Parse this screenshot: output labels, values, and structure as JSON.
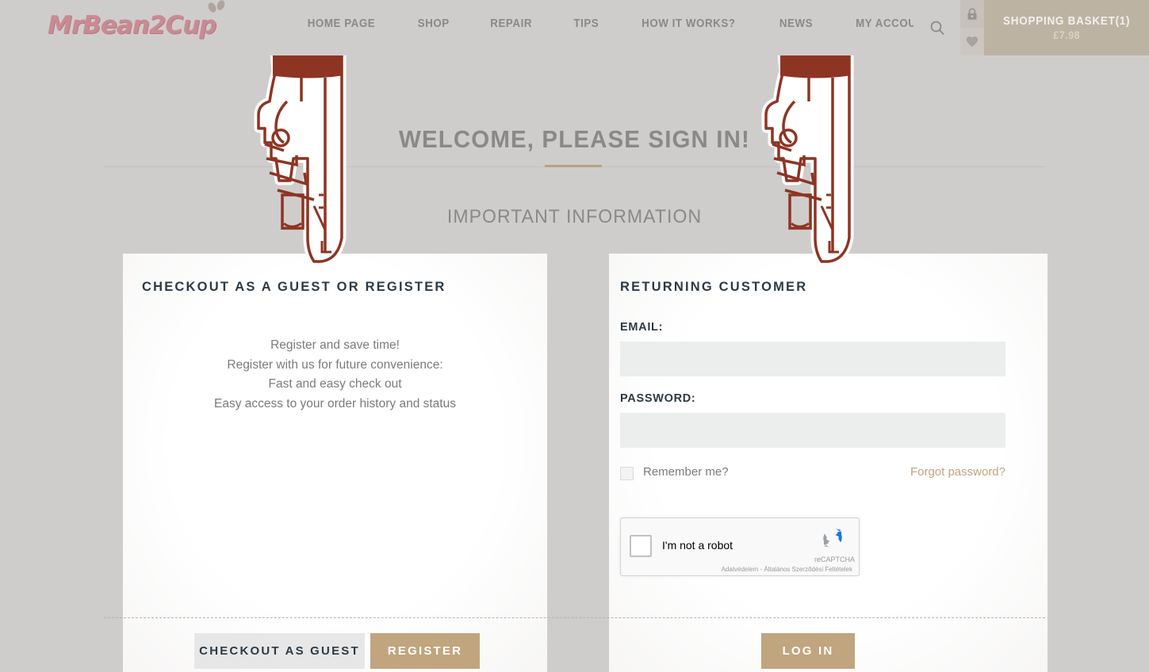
{
  "header": {
    "logo_text": "MrBean2Cup",
    "nav": [
      {
        "label": "HOME PAGE"
      },
      {
        "label": "SHOP"
      },
      {
        "label": "REPAIR"
      },
      {
        "label": "TIPS"
      },
      {
        "label": "HOW IT WORKS?"
      },
      {
        "label": "NEWS"
      },
      {
        "label": "MY ACCOUNT"
      }
    ],
    "search_icon": "search-icon",
    "lock_icon": "lock-icon",
    "wishlist_icon": "heart-icon",
    "basket": {
      "title": "SHOPPING BASKET(1)",
      "total": "£7.98"
    }
  },
  "main": {
    "page_title": "WELCOME, PLEASE SIGN IN!",
    "sub_title": "IMPORTANT INFORMATION"
  },
  "guest_panel": {
    "heading": "CHECKOUT AS A GUEST OR REGISTER",
    "copy_line1": "Register and save time!",
    "copy_line2": "Register with us for future convenience:",
    "copy_line3": "Fast and easy check out",
    "copy_line4": "Easy access to your order history and status",
    "checkout_button": "CHECKOUT AS GUEST",
    "register_button": "REGISTER"
  },
  "login_panel": {
    "heading": "RETURNING CUSTOMER",
    "email_label": "EMAIL:",
    "email_value": "",
    "email_placeholder": "",
    "password_label": "PASSWORD:",
    "password_value": "",
    "password_placeholder": "",
    "remember_label": "Remember me?",
    "forgot_link": "Forgot password?",
    "login_button": "LOG IN",
    "recaptcha": {
      "checkbox_label": "I'm not a robot",
      "brand": "reCAPTCHA",
      "terms": "Adatvédelem - Általános Szerződési Feltételek"
    }
  },
  "colors": {
    "page_background": "#cfcdcb",
    "accent_tan": "#c0a57e",
    "basket_background": "#bdb3a3",
    "logo_pink": "#c98b93",
    "heading_dark": "#2d3a45",
    "deco_maroon": "#8e3423"
  }
}
